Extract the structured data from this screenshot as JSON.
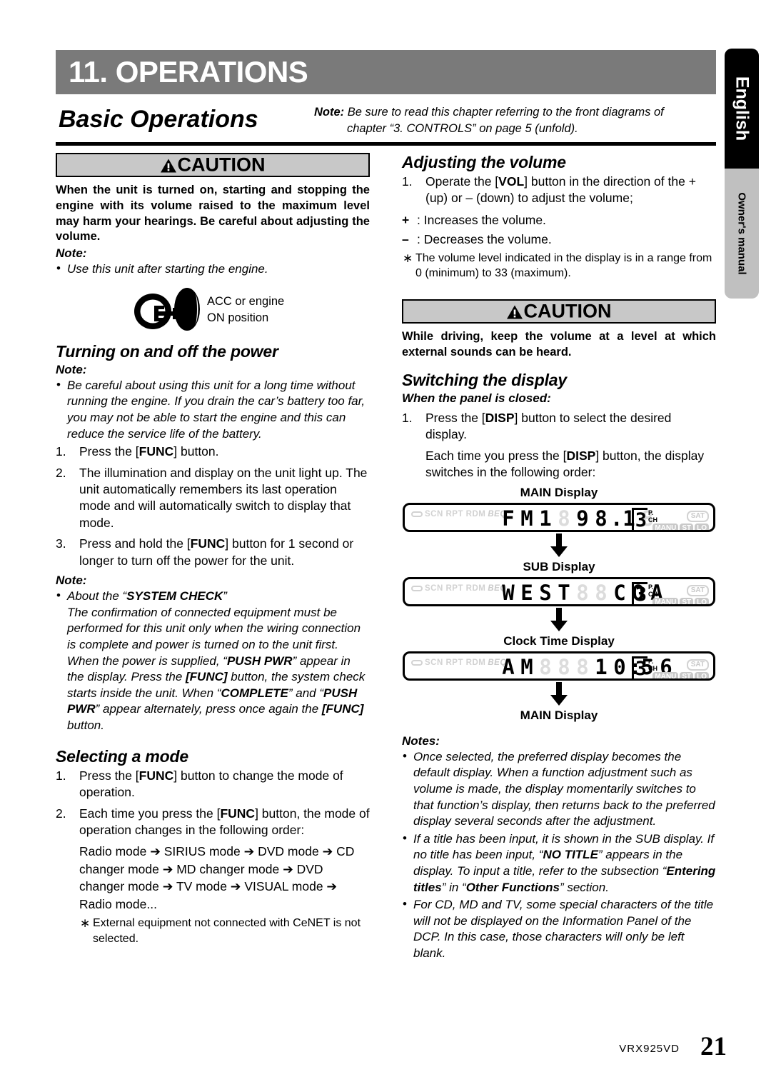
{
  "side_tab": {
    "language": "English",
    "manual": "Owner's manual"
  },
  "chapter": {
    "banner_title": "11. OPERATIONS",
    "section_title": "Basic Operations",
    "head_note_label": "Note:",
    "head_note_line1": "Be sure to read this chapter referring to the front diagrams of",
    "head_note_line2": "chapter “3. CONTROLS” on page 5 (unfold)."
  },
  "caution_left": {
    "caption": "CAUTION",
    "body": "When the unit is turned on, starting and stopping the engine with its volume raised to the maximum level may harm your hearings.  Be careful about adjusting the volume.",
    "note_label": "Note:",
    "note_bullet": "Use this unit after starting the engine.",
    "key_label_line1": "ACC or engine",
    "key_label_line2": "ON position"
  },
  "turning_power": {
    "heading": "Turning on and off the power",
    "note_label": "Note:",
    "note_bullet": "Be careful about using this unit for a long time without running the engine. If you drain the car’s battery too far, you may not be able to start the engine and this can reduce the service life of the battery.",
    "steps": [
      {
        "num": "1.",
        "pre": "Press the [",
        "bold": "FUNC",
        "post": "] button."
      },
      {
        "num": "2.",
        "text": "The illumination and display on the unit light up. The unit automatically remembers its last operation mode and will automatically switch to display that mode."
      },
      {
        "num": "3.",
        "pre": "Press and hold the [",
        "bold": "FUNC",
        "post": "] button for 1 second or longer to turn off the power for the unit."
      }
    ],
    "note2_label": "Note:",
    "syscheck_bullet_head": "About the “",
    "syscheck_bold": "SYSTEM CHECK",
    "syscheck_bullet_tail": "”",
    "syscheck_body_a": "The confirmation of connected equipment must be performed for this unit only when the wiring connection is complete and power is turned on to the unit first. When the power is supplied, “",
    "syscheck_b1": "PUSH PWR",
    "syscheck_body_b": "” appear in the display. Press the ",
    "syscheck_b2": "[FUNC]",
    "syscheck_body_c": " button, the system check starts inside the unit. When “",
    "syscheck_b3": "COMPLETE",
    "syscheck_body_d": "” and “",
    "syscheck_b4": "PUSH PWR",
    "syscheck_body_e": "” appear alternately, press once again the ",
    "syscheck_b5": "[FUNC]",
    "syscheck_body_f": " button."
  },
  "selecting_mode": {
    "heading": "Selecting a mode",
    "step1_pre": "Press the [",
    "step1_bold": "FUNC",
    "step1_post": "] button to change the mode of operation.",
    "step1_num": "1.",
    "step2_num": "2.",
    "step2_pre": "Each time you press the [",
    "step2_bold": "FUNC",
    "step2_post": "] button, the mode of operation changes in the following order:",
    "mode_order": "Radio mode ➔ SIRIUS mode ➔  DVD mode ➔ CD changer mode ➔ MD changer mode ➔ DVD changer mode ➔ TV mode ➔ VISUAL mode ➔ Radio mode...",
    "star_note": "External equipment not connected with CeNET is not selected."
  },
  "adjusting_volume": {
    "heading": "Adjusting the volume",
    "step1_num": "1.",
    "step1_pre": "Operate the [",
    "step1_bold": "VOL",
    "step1_post": "] button in the direction of the + (up) or – (down) to adjust the volume;",
    "plus_sym": "+",
    "plus_text": ": Increases the volume.",
    "minus_sym": "–",
    "minus_text": ": Decreases the volume.",
    "star_note": "The volume level indicated in the display is in a range from 0 (minimum) to 33 (maximum)."
  },
  "caution_right": {
    "caption": "CAUTION",
    "body": "While driving, keep the volume at a level at which external sounds can be heard."
  },
  "switching_display": {
    "heading": "Switching the display",
    "subheading": "When the panel is closed:",
    "step1_num": "1.",
    "step1_pre": "Press the [",
    "step1_bold": "DISP",
    "step1_post": "] button to select the desired display.",
    "para_pre": "Each time you press the [",
    "para_bold": "DISP",
    "para_post": "] button, the display switches in the following order:",
    "flow": [
      {
        "label": "MAIN Display",
        "lcd": {
          "segments": "FM1  98.1",
          "preset": "3",
          "preset_caps_top": "P.",
          "preset_caps_bottom": "CH"
        }
      },
      {
        "label": "SUB Display",
        "lcd": {
          "segments": "WEST  COA",
          "preset": "3",
          "preset_caps_top": "P.",
          "preset_caps_bottom": "CH"
        }
      },
      {
        "label": "Clock Time Display",
        "lcd": {
          "segments": "AM   10:56",
          "preset": "3",
          "preset_caps_top": "P.",
          "preset_caps_bottom": "CH"
        }
      }
    ],
    "flow_end_label": "MAIN Display",
    "lcd_indicators_left": "SCN RPT RDM",
    "lcd_indicator_beq": "BEQ",
    "lcd_indicator_sat": "SAT",
    "lcd_indicator_manu": "MANU",
    "lcd_indicator_st": "ST",
    "lcd_indicator_lo": "LO",
    "notes_label": "Notes:",
    "notes": [
      {
        "text": "Once selected, the preferred display becomes the default display. When a function adjustment such as volume is made, the display momentarily switches to that function’s display, then returns back to the preferred display several seconds after the adjustment."
      },
      {
        "a": "If a title has been input, it is shown in the SUB display. If no title has been input, “",
        "b1": "NO TITLE",
        "c": "” appears in the display. To input a title, refer to the subsection “",
        "b2": "Entering titles",
        "d": "” in “",
        "b3": "Other Functions",
        "e": "” section."
      },
      {
        "text": "For CD, MD and TV, some special characters of the title will not be displayed on the Information Panel of the DCP. In this case, those characters will only be left blank."
      }
    ]
  },
  "footer": {
    "model": "VRX925VD",
    "page": "21"
  }
}
